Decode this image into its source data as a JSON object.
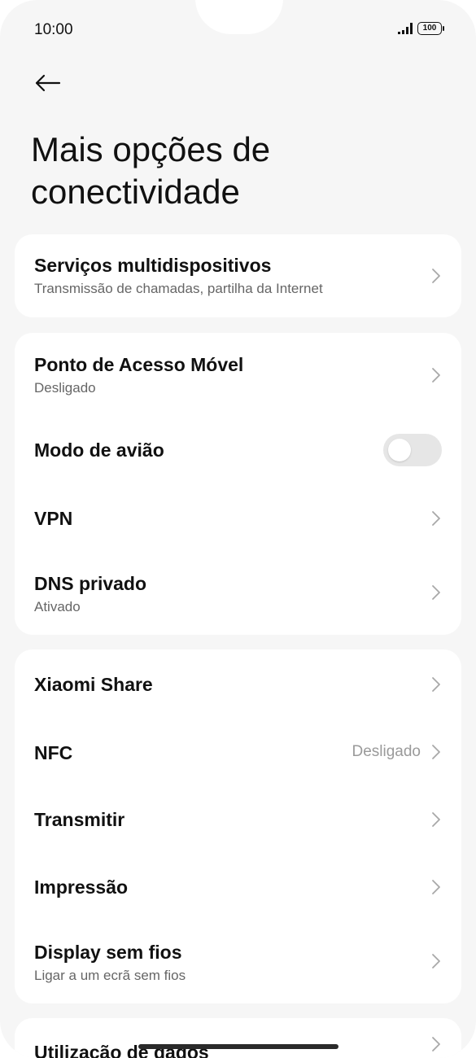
{
  "status_bar": {
    "time": "10:00",
    "battery": "100"
  },
  "header": {
    "title": "Mais opções de conectividade"
  },
  "groups": [
    {
      "items": [
        {
          "title": "Serviços multidispositivos",
          "subtitle": "Transmissão de chamadas, partilha da Internet"
        }
      ]
    },
    {
      "items": [
        {
          "title": "Ponto de Acesso Móvel",
          "subtitle": "Desligado"
        },
        {
          "title": "Modo de avião",
          "toggle": false
        },
        {
          "title": "VPN"
        },
        {
          "title": "DNS privado",
          "subtitle": "Ativado"
        }
      ]
    },
    {
      "items": [
        {
          "title": "Xiaomi Share"
        },
        {
          "title": "NFC",
          "value": "Desligado"
        },
        {
          "title": "Transmitir"
        },
        {
          "title": "Impressão"
        },
        {
          "title": "Display sem fios",
          "subtitle": "Ligar a um ecrã sem fios"
        }
      ]
    },
    {
      "items": [
        {
          "title": "Utilização de dados"
        }
      ]
    }
  ],
  "colors": {
    "background": "#f6f6f6",
    "card": "#ffffff",
    "toggle_off": "#e6e6e6"
  }
}
